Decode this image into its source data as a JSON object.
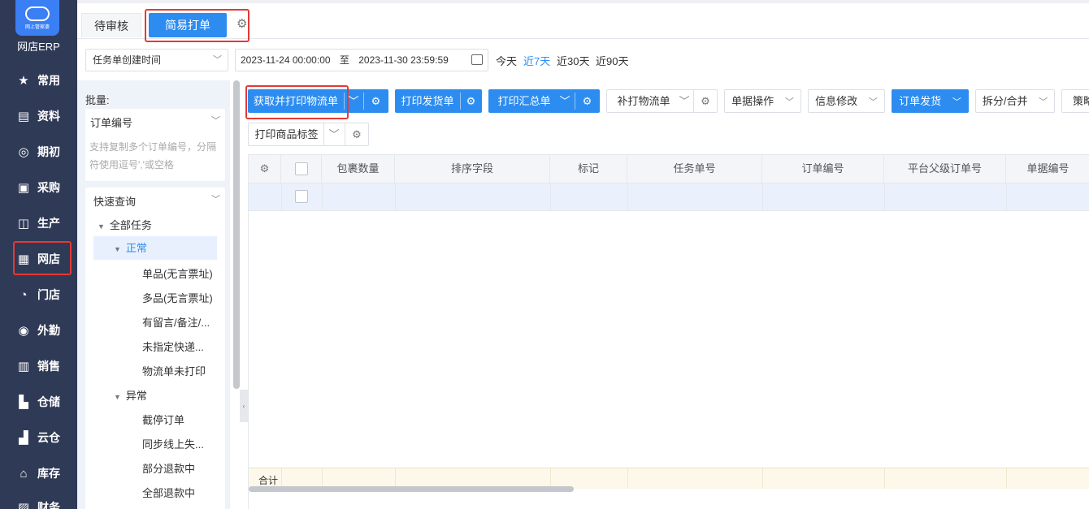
{
  "brand": {
    "name": "网店ERP",
    "logo_small_text": "网上管家婆"
  },
  "nav": {
    "items": [
      {
        "label": "常用",
        "icon": "star-icon"
      },
      {
        "label": "资料",
        "icon": "document-icon"
      },
      {
        "label": "期初",
        "icon": "target-icon"
      },
      {
        "label": "采购",
        "icon": "cart-icon"
      },
      {
        "label": "生产",
        "icon": "factory-icon"
      },
      {
        "label": "网店",
        "icon": "shop-icon"
      },
      {
        "label": "门店",
        "icon": "store-pie-icon"
      },
      {
        "label": "外勤",
        "icon": "field-icon"
      },
      {
        "label": "销售",
        "icon": "chart-icon"
      },
      {
        "label": "仓储",
        "icon": "warehouse-icon"
      },
      {
        "label": "云仓",
        "icon": "cloud-warehouse-icon"
      },
      {
        "label": "库存",
        "icon": "home-icon"
      },
      {
        "label": "财务",
        "icon": "finance-icon"
      }
    ]
  },
  "tabs": {
    "pending": "待审核",
    "active": "简易打单"
  },
  "filter": {
    "date_type": "任务单创建时间",
    "start": "2023-11-24 00:00:00",
    "to": "至",
    "end": "2023-11-30 23:59:59",
    "quick": [
      "今天",
      "近7天",
      "近30天",
      "近90天"
    ]
  },
  "panel": {
    "batch_label": "批量:",
    "order_field": "订单编号",
    "hint": "支持复制多个订单编号，分隔符使用逗号','或空格",
    "quick_query": "快速查询",
    "tree": {
      "all": "全部任务",
      "normal": "正常",
      "normal_children": [
        "单品(无言票址)",
        "多品(无言票址)",
        "有留言/备注/...",
        "未指定快递...",
        "物流单未打印"
      ],
      "abnormal": "异常",
      "abnormal_children": [
        "截停订单",
        "同步线上失...",
        "部分退款中",
        "全部退款中"
      ]
    }
  },
  "toolbar": {
    "get_print_logistics": "获取并打印物流单",
    "print_delivery": "打印发货单",
    "print_summary": "打印汇总单",
    "reprint_logistics": "补打物流单",
    "doc_ops": "单据操作",
    "info_modify": "信息修改",
    "order_ship": "订单发货",
    "split_merge": "拆分/合并",
    "strategy": "策略",
    "print_product_label": "打印商品标签"
  },
  "table": {
    "columns": [
      "包裹数量",
      "排序字段",
      "标记",
      "任务单号",
      "订单编号",
      "平台父级订单号",
      "单据编号"
    ],
    "footer_label": "合计"
  },
  "colors": {
    "primary": "#2d8cf0",
    "sidebar": "#2f3a56",
    "highlight": "#e53935"
  }
}
